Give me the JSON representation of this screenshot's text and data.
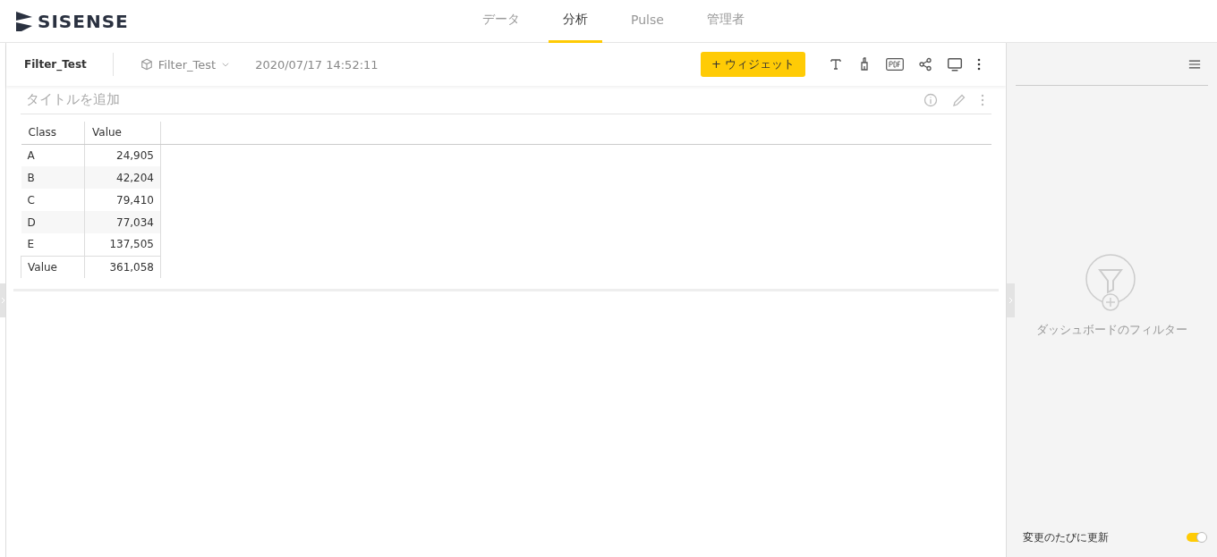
{
  "logo": {
    "text": "SISENSE"
  },
  "nav_tabs": [
    {
      "label": "データ",
      "selected": false
    },
    {
      "label": "分析",
      "selected": true
    },
    {
      "label": "Pulse",
      "selected": false
    },
    {
      "label": "管理者",
      "selected": false
    }
  ],
  "toolbar": {
    "dashboard_title": "Filter_Test",
    "datasource": "Filter_Test",
    "updated": "2020/07/17 14:52:11",
    "add_widget": "+ ウィジェット"
  },
  "widget": {
    "title_placeholder": "タイトルを追加",
    "table": {
      "columns": [
        "Class",
        "Value"
      ],
      "rows": [
        [
          "A",
          "24,905"
        ],
        [
          "B",
          "42,204"
        ],
        [
          "C",
          "79,410"
        ],
        [
          "D",
          "77,034"
        ],
        [
          "E",
          "137,505"
        ]
      ],
      "total": [
        "Value",
        "361,058"
      ]
    }
  },
  "filters_panel": {
    "empty_label": "ダッシュボードのフィルター",
    "auto_update": {
      "label": "変更のたびに更新",
      "on": true
    }
  }
}
